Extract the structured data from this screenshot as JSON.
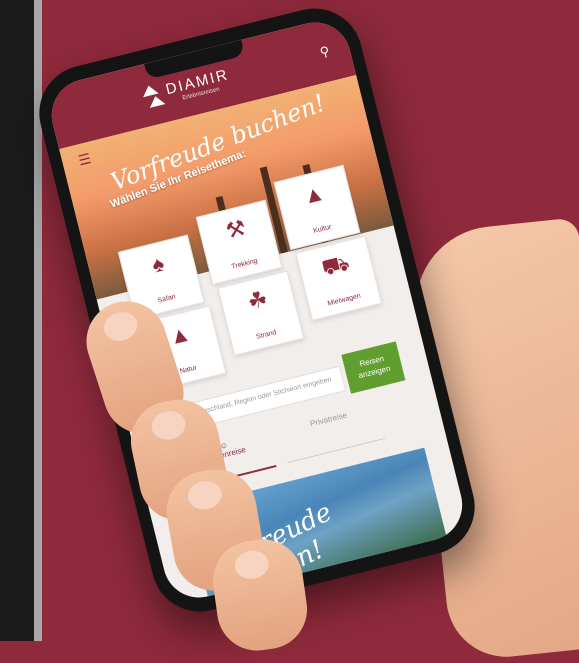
{
  "app": {
    "brand": "DIAMIR",
    "tagline": "Erlebnisreisen"
  },
  "hero": {
    "title": "Vorfreude buchen!",
    "subtitle": "Wählen Sie Ihr Reisethema:"
  },
  "categories": [
    {
      "label": "Safari",
      "icon": "elephant-icon"
    },
    {
      "label": "Trekking",
      "icon": "hiker-icon"
    },
    {
      "label": "Kultur",
      "icon": "pyramid-icon"
    },
    {
      "label": "Natur",
      "icon": "mountain-icon"
    },
    {
      "label": "Strand",
      "icon": "palm-icon"
    },
    {
      "label": "Mietwagen",
      "icon": "car-icon"
    }
  ],
  "search": {
    "placeholder": "Einfach Wunschland, Region oder Stichwort eingeben",
    "button": "Reisen anzeigen"
  },
  "tabs": [
    {
      "label": "Gruppenreise",
      "active": true
    },
    {
      "label": "Privatreise",
      "active": false
    }
  ],
  "banner": {
    "title": "Vorfreude buchen!"
  },
  "colors": {
    "brand": "#8e2a3b",
    "button": "#5f9e2f"
  }
}
